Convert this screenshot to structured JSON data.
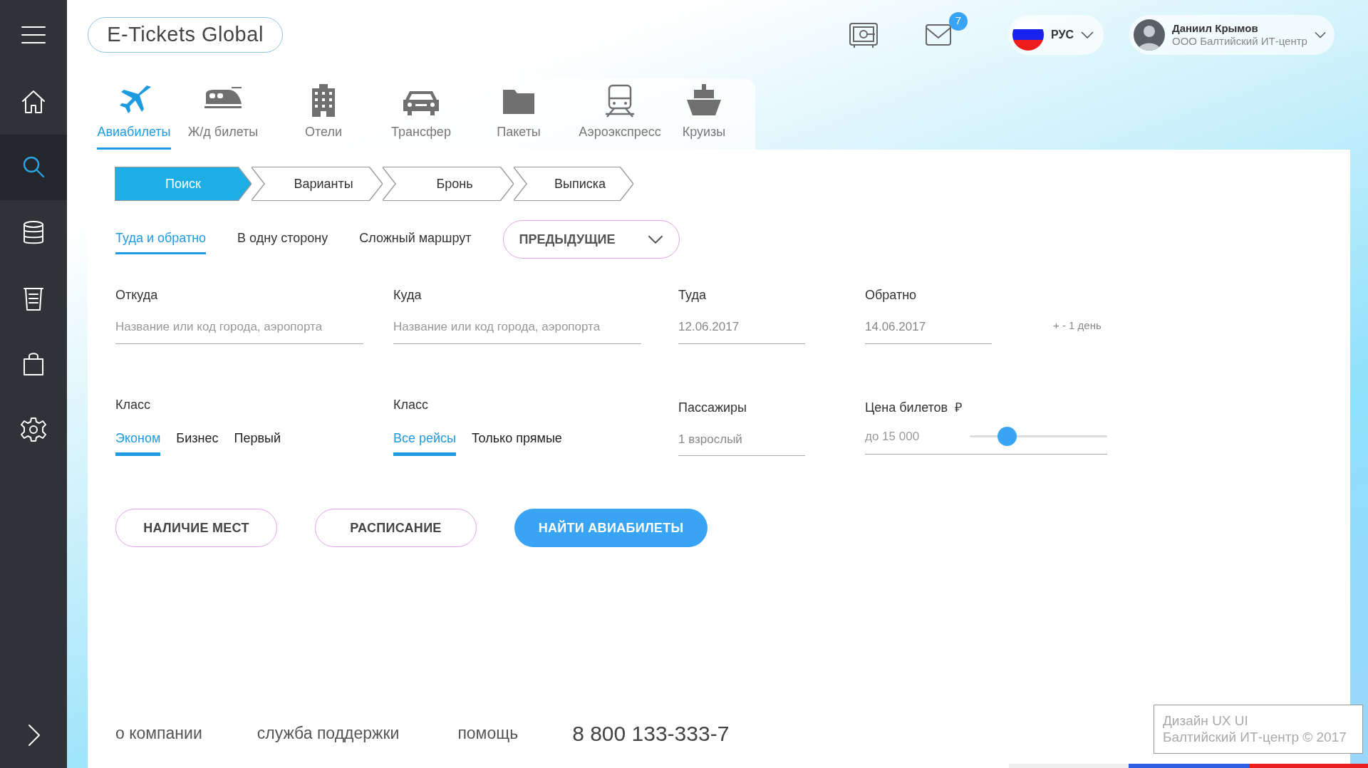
{
  "sidebar": {
    "items": [
      {
        "kind": "menu",
        "selected": false
      },
      {
        "kind": "home",
        "selected": false
      },
      {
        "kind": "search",
        "selected": true
      },
      {
        "kind": "database",
        "selected": false
      },
      {
        "kind": "list",
        "selected": false
      },
      {
        "kind": "bag",
        "selected": false
      },
      {
        "kind": "settings",
        "selected": false
      }
    ],
    "expand": {
      "kind": "chevron"
    }
  },
  "header": {
    "logo": "E-Tickets Global",
    "mail_badge": "7",
    "language": "РУС",
    "user": {
      "name": "Даниил Крымов",
      "company": "ООО Балтийский ИТ-центр"
    }
  },
  "service_tabs": [
    {
      "kind": "plane",
      "label": "Авиабилеты",
      "selected": true
    },
    {
      "kind": "train",
      "label": "Ж/д билеты",
      "selected": false
    },
    {
      "kind": "hotel",
      "label": "Отели",
      "selected": false
    },
    {
      "kind": "car",
      "label": "Трансфер",
      "selected": false
    },
    {
      "kind": "folder",
      "label": "Пакеты",
      "selected": false
    },
    {
      "kind": "express",
      "label": "Аэроэкспресс",
      "selected": false
    },
    {
      "kind": "ship",
      "label": "Круизы",
      "selected": false
    }
  ],
  "steps": [
    {
      "label": "Поиск",
      "selected": true
    },
    {
      "label": "Варианты",
      "selected": false
    },
    {
      "label": "Бронь",
      "selected": false
    },
    {
      "label": "Выписка",
      "selected": false
    }
  ],
  "trip_types": [
    {
      "label": "Туда и обратно",
      "selected": true
    },
    {
      "label": "В одну сторону",
      "selected": false
    },
    {
      "label": "Сложный маршрут",
      "selected": false
    }
  ],
  "previous_dropdown": "ПРЕДЫДУЩИЕ",
  "fields": [
    {
      "label": "Откуда",
      "placeholder": "Название или код города, аэропорта"
    },
    {
      "label": "Куда",
      "placeholder": "Название или код города, аэропорта"
    },
    {
      "label": "Туда",
      "value": "12.06.2017"
    },
    {
      "label": "Обратно",
      "value": "14.06.2017",
      "extra": "+ - 1 день"
    }
  ],
  "class_group": {
    "label": "Класс",
    "options": [
      {
        "label": "Эконом",
        "selected": true
      },
      {
        "label": "Бизнес",
        "selected": false
      },
      {
        "label": "Первый",
        "selected": false
      }
    ]
  },
  "flights_group": {
    "label": "Класс",
    "options": [
      {
        "label": "Все рейсы",
        "selected": true
      },
      {
        "label": "Только прямые",
        "selected": false
      }
    ]
  },
  "passengers": {
    "label": "Пассажиры",
    "value": "1 взрослый"
  },
  "price": {
    "label": "Цена билетов",
    "currency": "₽",
    "value": "до 15 000",
    "level": 0.27
  },
  "buttons": [
    {
      "kind": "outline",
      "label": "НАЛИЧИЕ МЕСТ"
    },
    {
      "kind": "outline",
      "label": "РАСПИСАНИЕ"
    },
    {
      "kind": "primary",
      "label": "НАЙТИ АВИАБИЛЕТЫ"
    }
  ],
  "footer": {
    "links": [
      "о компании",
      "служба поддержки",
      "помощь"
    ],
    "phone": "8 800 133-333-7",
    "credit": [
      "Дизайн UX UI",
      "Балтийский ИТ-центр © 2017"
    ]
  }
}
